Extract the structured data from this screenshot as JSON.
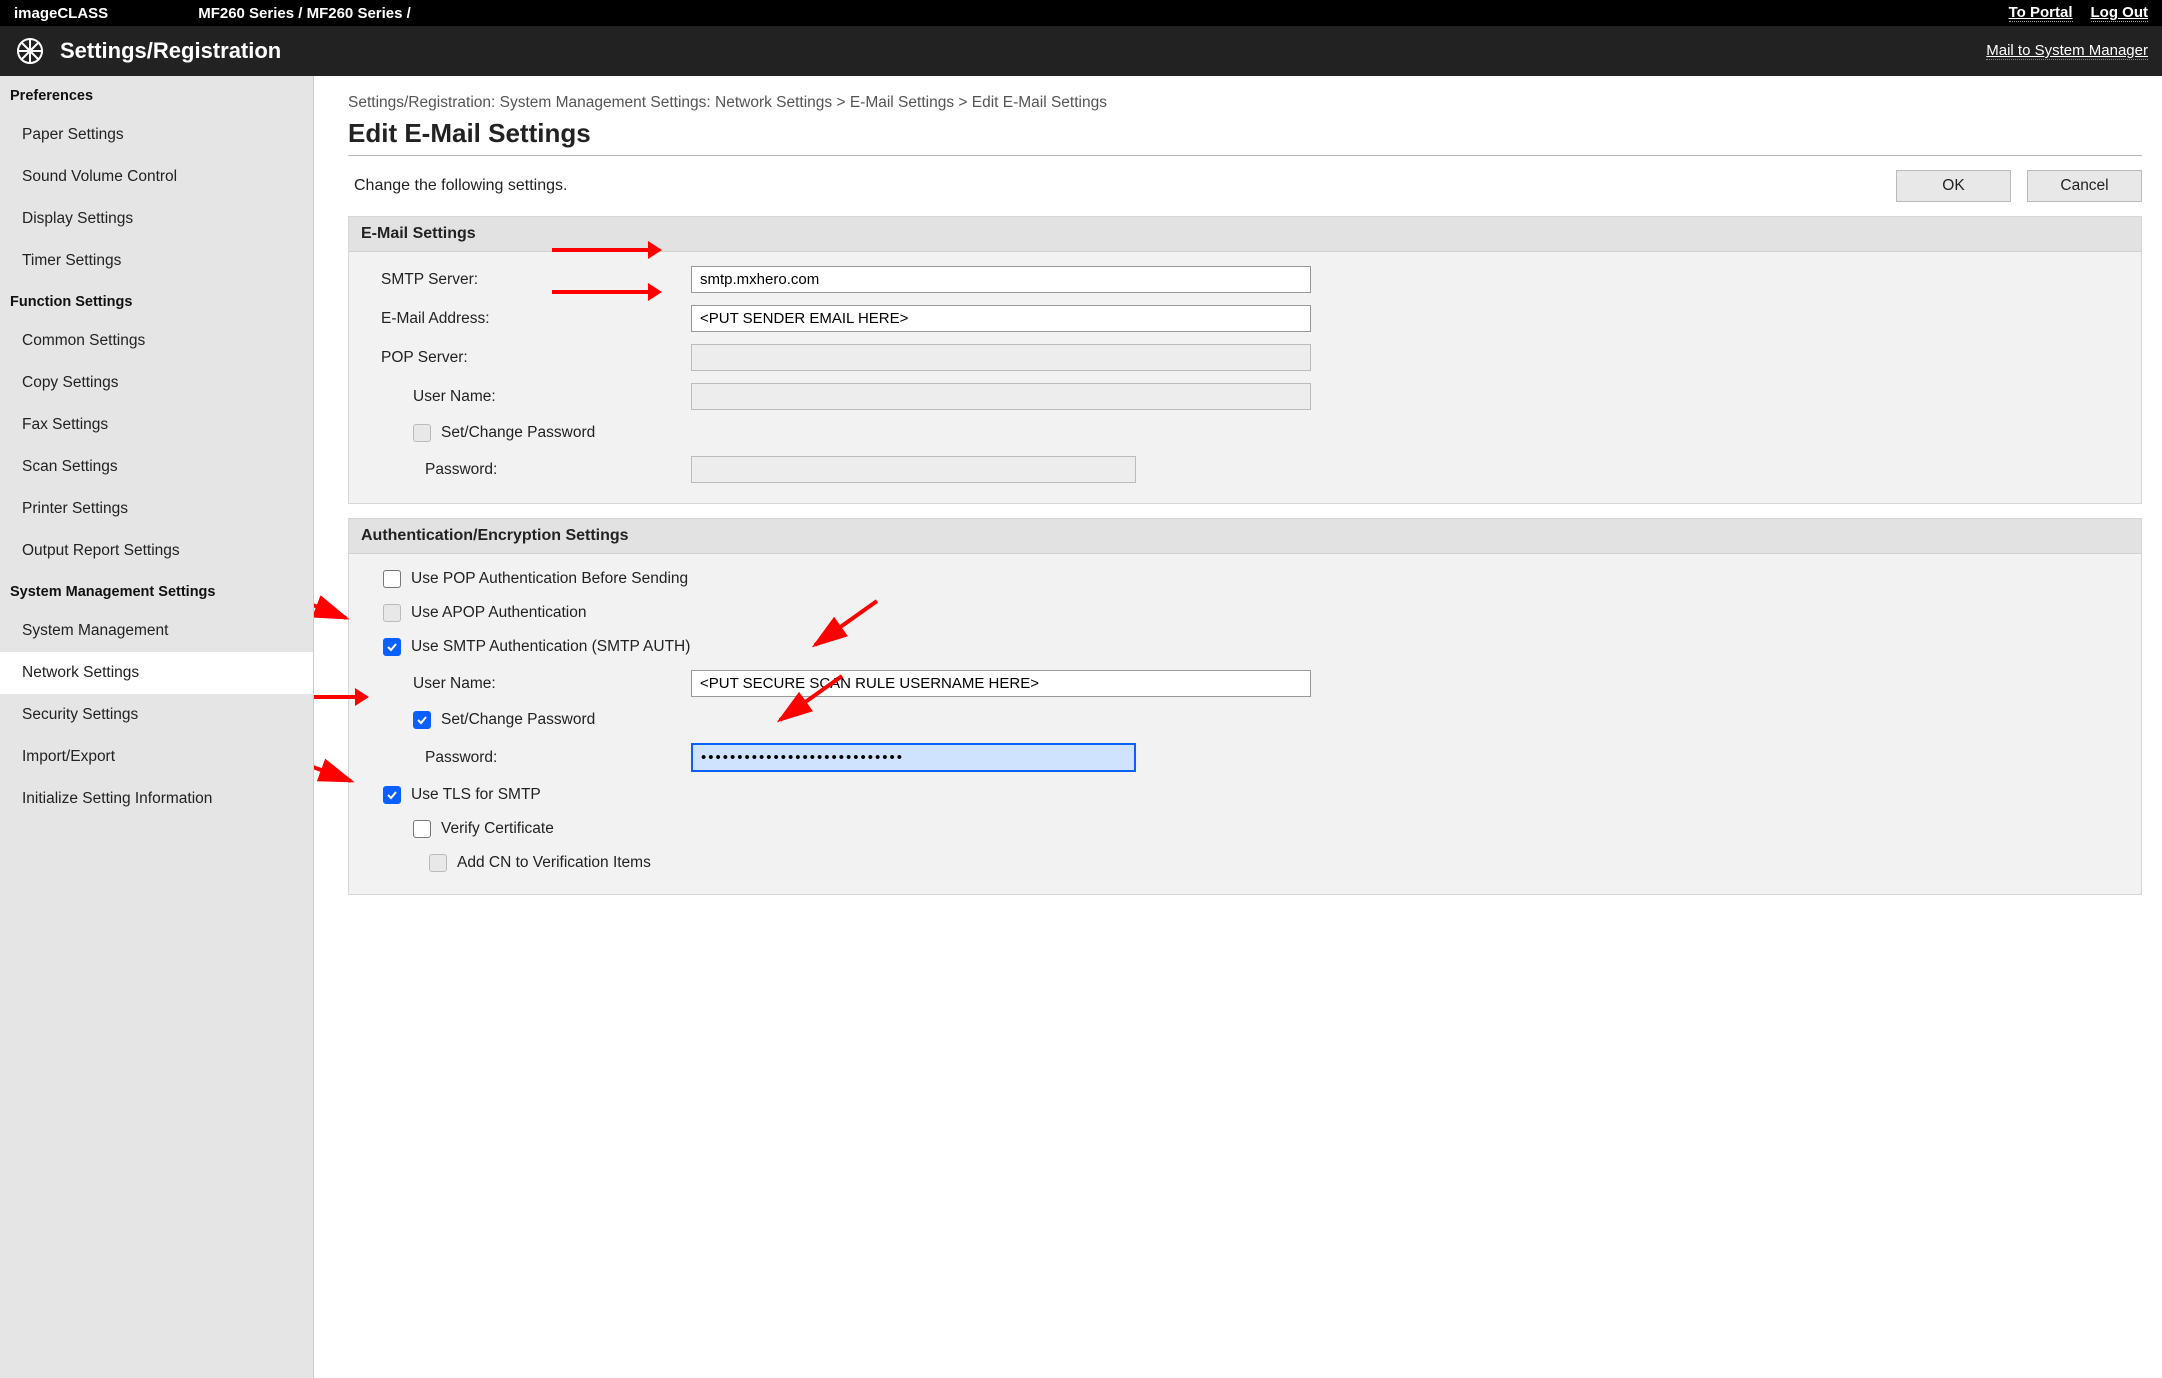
{
  "topbar": {
    "brand": "imageCLASS",
    "model": "MF260 Series / MF260 Series /",
    "to_portal": "To Portal",
    "log_out": "Log Out"
  },
  "headerbar": {
    "title": "Settings/Registration",
    "mail_to": "Mail to System Manager"
  },
  "sidebar": {
    "groups": [
      {
        "header": "Preferences",
        "items": [
          "Paper Settings",
          "Sound Volume Control",
          "Display Settings",
          "Timer Settings"
        ]
      },
      {
        "header": "Function Settings",
        "items": [
          "Common Settings",
          "Copy Settings",
          "Fax Settings",
          "Scan Settings",
          "Printer Settings",
          "Output Report Settings"
        ]
      },
      {
        "header": "System Management Settings",
        "items": [
          "System Management",
          "Network Settings",
          "Security Settings",
          "Import/Export",
          "Initialize Setting Information"
        ]
      }
    ],
    "active": "Network Settings"
  },
  "breadcrumb": "Settings/Registration: System Management Settings: Network Settings > E-Mail Settings > Edit E-Mail Settings",
  "page_title": "Edit E-Mail Settings",
  "action": {
    "instruction": "Change the following settings.",
    "ok": "OK",
    "cancel": "Cancel"
  },
  "panel_email": {
    "header": "E-Mail Settings",
    "smtp_label": "SMTP Server:",
    "smtp_value": "smtp.mxhero.com",
    "email_label": "E-Mail Address:",
    "email_value": "<PUT SENDER EMAIL HERE>",
    "pop_label": "POP Server:",
    "pop_value": "",
    "user_label": "User Name:",
    "user_value": "",
    "setpwd_label": "Set/Change Password",
    "pwd_label": "Password:",
    "pwd_value": ""
  },
  "panel_auth": {
    "header": "Authentication/Encryption Settings",
    "pop_auth": "Use POP Authentication Before Sending",
    "apop": "Use APOP Authentication",
    "smtp_auth": "Use SMTP Authentication (SMTP AUTH)",
    "user_label": "User Name:",
    "user_value": "<PUT SECURE SCAN RULE USERNAME HERE>",
    "setpwd_label": "Set/Change Password",
    "pwd_label": "Password:",
    "pwd_value": "••••••••••••••••••••••••••••",
    "tls_label": "Use TLS for SMTP",
    "verify_cert": "Verify Certificate",
    "add_cn": "Add CN to Verification Items"
  }
}
